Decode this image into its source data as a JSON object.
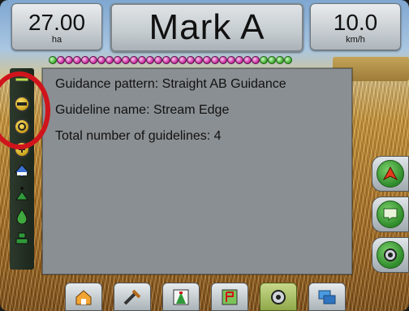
{
  "header": {
    "area_value": "27.00",
    "area_unit": "ha",
    "title": "Mark A",
    "speed_value": "10.0",
    "speed_unit": "km/h"
  },
  "guidance_info": {
    "pattern": "Guidance pattern: Straight AB Guidance",
    "guideline_name": "Guideline name: Stream Edge",
    "total": "Total number of guidelines: 4"
  },
  "boom_sections": {
    "count": 30,
    "green_indices": [
      0,
      26,
      27,
      28,
      29
    ]
  },
  "left_toolbar": [
    "straight-ab-icon",
    "pivot-icon",
    "steering-icon",
    "tilt-sensor-icon",
    "marker-a-icon",
    "fuel-drop-icon",
    "vehicle-icon"
  ],
  "right_buttons": [
    "guidance-mode-icon",
    "view-toggle-icon",
    "camera-icon"
  ],
  "bottom_nav": [
    "home-icon",
    "tools-icon",
    "guidance-icon",
    "map-icon",
    "camera-icon",
    "layers-icon"
  ],
  "colors": {
    "alert_ring": "#d0141c",
    "panel": "#8a8f93",
    "active_tab": "#9fb34f"
  }
}
